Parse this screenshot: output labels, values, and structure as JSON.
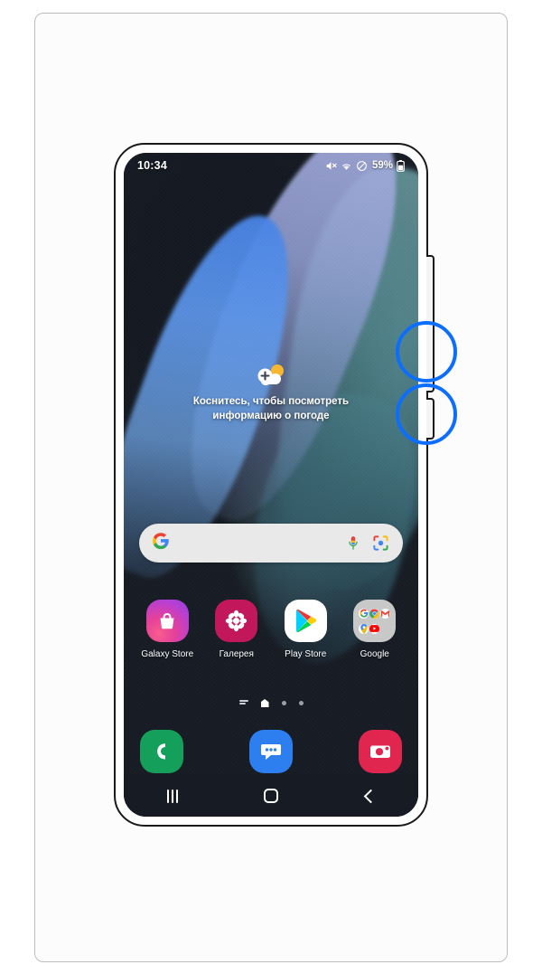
{
  "device": {
    "type": "samsung-galaxy-phone",
    "side_buttons": [
      {
        "name": "volume-rocker",
        "label": "Volume"
      },
      {
        "name": "power-button",
        "label": "Power / Side key"
      }
    ],
    "annotations": {
      "color": "#0d6efd",
      "circles": [
        {
          "name": "annotation-circle-volume",
          "target": "volume-rocker"
        },
        {
          "name": "annotation-circle-power",
          "target": "power-button"
        }
      ]
    }
  },
  "status_bar": {
    "time": "10:34",
    "battery_percent": "59%",
    "icons": [
      "mute-icon",
      "wifi-icon",
      "do-not-disturb-icon",
      "battery-icon"
    ]
  },
  "weather_widget": {
    "icon": "weather-add-cloud-sun-icon",
    "text": "Коснитесь, чтобы посмотреть информацию о погоде"
  },
  "search_bar": {
    "google_logo": "google-g-icon",
    "placeholder": "",
    "value": "",
    "actions": [
      {
        "name": "voice-search-icon",
        "label": "Голосовой поиск"
      },
      {
        "name": "google-lens-icon",
        "label": "Google Объектив"
      }
    ]
  },
  "apps": [
    {
      "label": "Galaxy Store",
      "icon": "galaxy-store-icon"
    },
    {
      "label": "Галерея",
      "icon": "gallery-icon"
    },
    {
      "label": "Play Store",
      "icon": "play-store-icon"
    },
    {
      "label": "Google",
      "icon": "google-folder-icon",
      "folder_items": [
        "google-icon",
        "chrome-icon",
        "gmail-icon",
        "maps-icon",
        "youtube-icon"
      ]
    }
  ],
  "page_indicator": {
    "items": [
      "apps-list-glyph",
      "home-page-active",
      "page-dot",
      "page-dot"
    ],
    "active_index": 1
  },
  "dock": [
    {
      "label": "Телефон",
      "icon": "phone-icon"
    },
    {
      "label": "Сообщения",
      "icon": "messages-icon"
    },
    {
      "label": "Камера",
      "icon": "camera-icon"
    }
  ],
  "nav_bar": [
    {
      "label": "Последние приложения",
      "icon": "recents-icon"
    },
    {
      "label": "Главный экран",
      "icon": "home-icon"
    },
    {
      "label": "Назад",
      "icon": "back-icon"
    }
  ],
  "colors": {
    "annotation_blue": "#0d6efd",
    "screen_dark": "#171c24",
    "frame_outline": "#1a1a1a",
    "card_border": "#bdbdbd"
  }
}
